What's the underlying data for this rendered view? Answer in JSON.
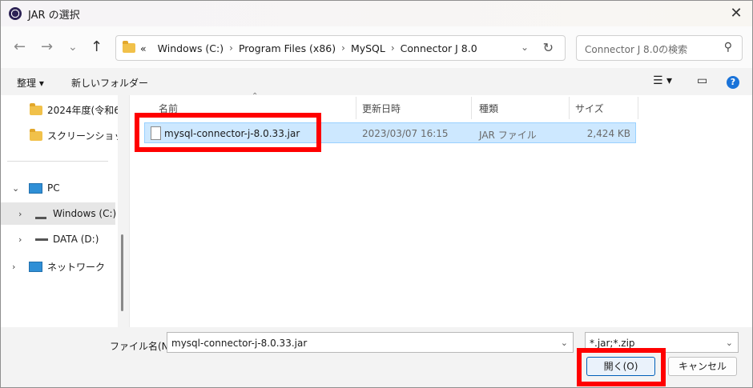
{
  "window": {
    "title": "JAR の選択",
    "close": "✕"
  },
  "nav": {
    "back": "←",
    "forward": "→",
    "recent": "⌄",
    "up": "↑"
  },
  "address": {
    "more": "«",
    "crumbs": [
      "Windows (C:)",
      "Program Files (x86)",
      "MySQL",
      "Connector J 8.0"
    ],
    "dropdown": "⌄",
    "refresh": "↻"
  },
  "search": {
    "placeholder": "Connector J 8.0の検索",
    "icon": "search-icon"
  },
  "toolbar": {
    "organize": "整理 ▾",
    "new_folder": "新しいフォルダー",
    "view": "☰ ▾",
    "pane": "▭",
    "help": "?"
  },
  "sidebar": {
    "items": [
      {
        "label": "2024年度(令和6",
        "icon": "folder-icon"
      },
      {
        "label": "スクリーンショット",
        "icon": "folder-icon"
      },
      {
        "label": "PC",
        "icon": "pc-icon"
      },
      {
        "label": "Windows (C:)",
        "icon": "drive-icon"
      },
      {
        "label": "DATA (D:)",
        "icon": "drive-icon"
      },
      {
        "label": "ネットワーク",
        "icon": "network-icon"
      }
    ]
  },
  "columns": {
    "name": "名前",
    "modified": "更新日時",
    "type": "種類",
    "size": "サイズ"
  },
  "files": [
    {
      "name": "mysql-connector-j-8.0.33.jar",
      "modified": "2023/03/07 16:15",
      "type": "JAR ファイル",
      "size": "2,424 KB"
    }
  ],
  "footer": {
    "filename_label": "ファイル名(N):",
    "filename_value": "mysql-connector-j-8.0.33.jar",
    "filter_value": "*.jar;*.zip",
    "open_label": "開く(O)",
    "cancel_label": "キャンセル"
  },
  "colors": {
    "highlight": "#ff0000",
    "selection": "#cde8ff",
    "accent": "#005fb8"
  }
}
